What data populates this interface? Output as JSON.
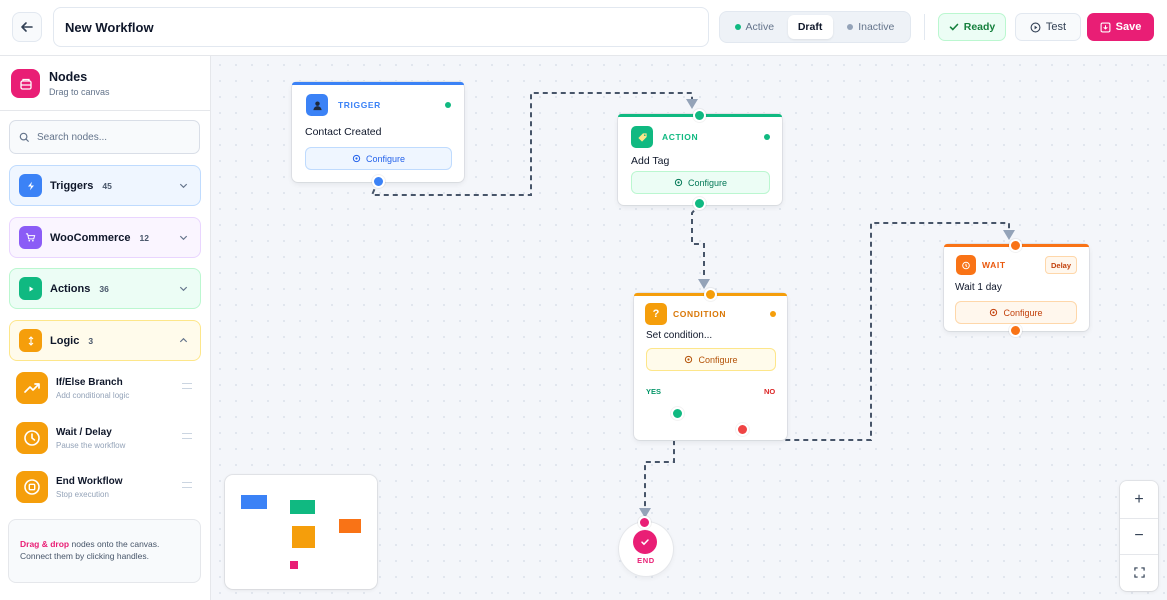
{
  "header": {
    "back_icon": "arrow-left-icon",
    "workflow_name": "New Workflow",
    "status_options": [
      {
        "label": "Active",
        "color": "#10b981"
      },
      {
        "label": "Draft",
        "selected": true
      },
      {
        "label": "Inactive",
        "color": "#94a3b8"
      }
    ],
    "ready_label": "Ready",
    "test_label": "Test",
    "save_label": "Save",
    "save_color": "#e91e75"
  },
  "sidebar": {
    "title": "Nodes",
    "subtitle": "Drag to canvas",
    "search_placeholder": "Search nodes...",
    "categories": [
      {
        "label": "Triggers",
        "count": "45",
        "color": "#3b82f6",
        "icon": "zap-icon",
        "expanded": false
      },
      {
        "label": "WooCommerce",
        "count": "12",
        "color": "#8b5cf6",
        "icon": "cart-icon",
        "expanded": false
      },
      {
        "label": "Actions",
        "count": "36",
        "color": "#10b981",
        "icon": "play-icon",
        "expanded": false
      },
      {
        "label": "Logic",
        "count": "3",
        "color": "#f59e0b",
        "icon": "branch-icon",
        "expanded": true
      }
    ],
    "logic_items": [
      {
        "title": "If/Else Branch",
        "subtitle": "Add conditional logic",
        "icon": "trend-icon"
      },
      {
        "title": "Wait / Delay",
        "subtitle": "Pause the workflow",
        "icon": "clock-icon"
      },
      {
        "title": "End Workflow",
        "subtitle": "Stop execution",
        "icon": "stop-icon"
      }
    ],
    "tip_bold": "Drag & drop",
    "tip_rest": " nodes onto the canvas. Connect them by clicking handles."
  },
  "canvas": {
    "nodes": {
      "trigger": {
        "type": "TRIGGER",
        "title": "Contact Created",
        "configure": "Configure",
        "color": "#3b82f6"
      },
      "action": {
        "type": "ACTION",
        "title": "Add Tag",
        "configure": "Configure",
        "color": "#10b981"
      },
      "condition": {
        "type": "CONDITION",
        "title": "Set condition...",
        "configure": "Configure",
        "yes": "YES",
        "no": "NO",
        "color": "#f59e0b"
      },
      "wait": {
        "type": "WAIT",
        "title": "Wait 1 day",
        "badge": "Delay",
        "configure": "Configure",
        "color": "#f97316"
      },
      "end": {
        "label": "END",
        "color": "#e91e75"
      }
    }
  },
  "zoom_controls": {
    "zoom_in": "+",
    "zoom_out": "−"
  }
}
